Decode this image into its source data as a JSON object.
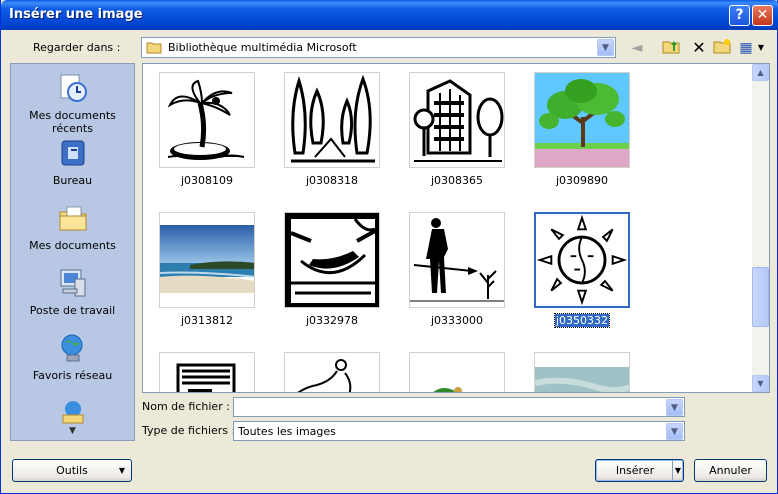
{
  "window": {
    "title": "Insérer une image",
    "help_glyph": "?",
    "close_glyph": "✕"
  },
  "toolbar": {
    "look_in_label": "Regarder dans :",
    "look_in_value": "Bibliothèque multimédia Microsoft",
    "dropdown_glyph": "▼",
    "back_glyph": "◄",
    "up_glyph": "↑",
    "delete_glyph": "✕",
    "views_glyph": "▦"
  },
  "places": {
    "items": [
      {
        "label": "Mes documents récents",
        "icon": "recent-documents-icon"
      },
      {
        "label": "Bureau",
        "icon": "desktop-icon"
      },
      {
        "label": "Mes documents",
        "icon": "my-documents-icon"
      },
      {
        "label": "Poste de travail",
        "icon": "my-computer-icon"
      },
      {
        "label": "Favoris réseau",
        "icon": "network-places-icon"
      },
      {
        "label": "",
        "icon": "network-folder-icon"
      }
    ],
    "scroll_glyph": "▼"
  },
  "files": {
    "items": [
      {
        "name": "j0308109"
      },
      {
        "name": "j0308318"
      },
      {
        "name": "j0308365"
      },
      {
        "name": "j0309890"
      },
      {
        "name": "j0313812"
      },
      {
        "name": "j0332978"
      },
      {
        "name": "j0333000"
      },
      {
        "name": "j0350332",
        "selected": true
      },
      {
        "name": ""
      },
      {
        "name": ""
      },
      {
        "name": ""
      },
      {
        "name": ""
      }
    ],
    "scroll_up_glyph": "▲",
    "scroll_down_glyph": "▼"
  },
  "form": {
    "filename_label": "Nom de fichier :",
    "filename_value": "",
    "filetype_label": "Type de fichiers :",
    "filetype_value": "Toutes les images"
  },
  "buttons": {
    "tools": "Outils",
    "insert": "Insérer",
    "cancel": "Annuler"
  },
  "colors": {
    "title_bar": "#0349d6",
    "selection": "#316ac5",
    "places_bg": "#b8c8e4"
  }
}
